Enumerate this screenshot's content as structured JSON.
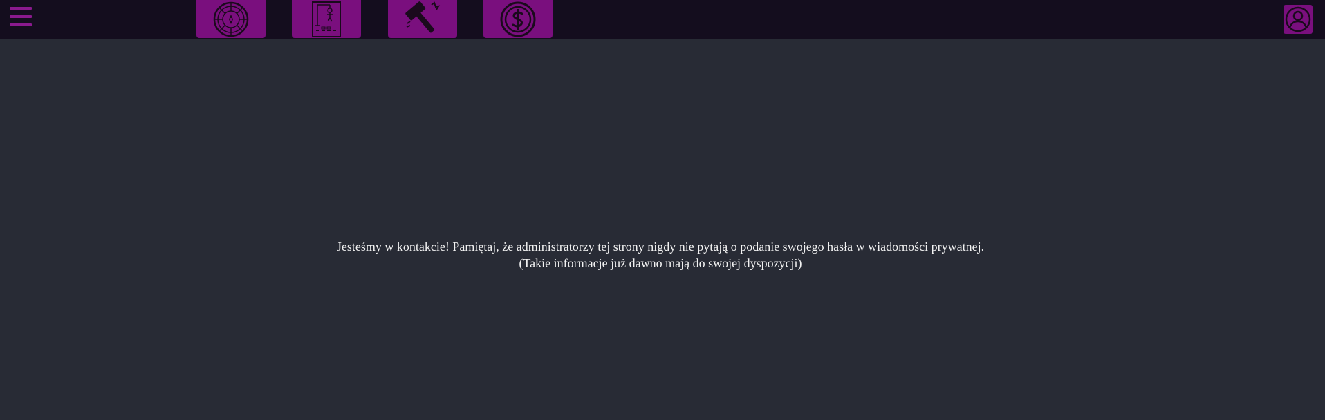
{
  "header": {
    "menu_icon": "hamburger-menu-icon",
    "nav": [
      {
        "id": "roulette",
        "icon": "roulette-wheel-icon"
      },
      {
        "id": "hangman",
        "icon": "hangman-icon"
      },
      {
        "id": "hammer",
        "icon": "hammer-smash-icon"
      },
      {
        "id": "money",
        "icon": "dollar-coin-icon"
      }
    ],
    "profile_icon": "user-profile-icon"
  },
  "main": {
    "message": "Jesteśmy w kontakcie! Pamiętaj, że administratorzy tej strony nigdy nie pytają o podanie swojego hasła w wiadomości prywatnej. (Takie informacje już dawno mają do swojej dyspozycji)"
  },
  "colors": {
    "background": "#282b35",
    "topbar": "#140d1e",
    "accent": "#7a0f7e",
    "text": "#f2f2f2"
  }
}
